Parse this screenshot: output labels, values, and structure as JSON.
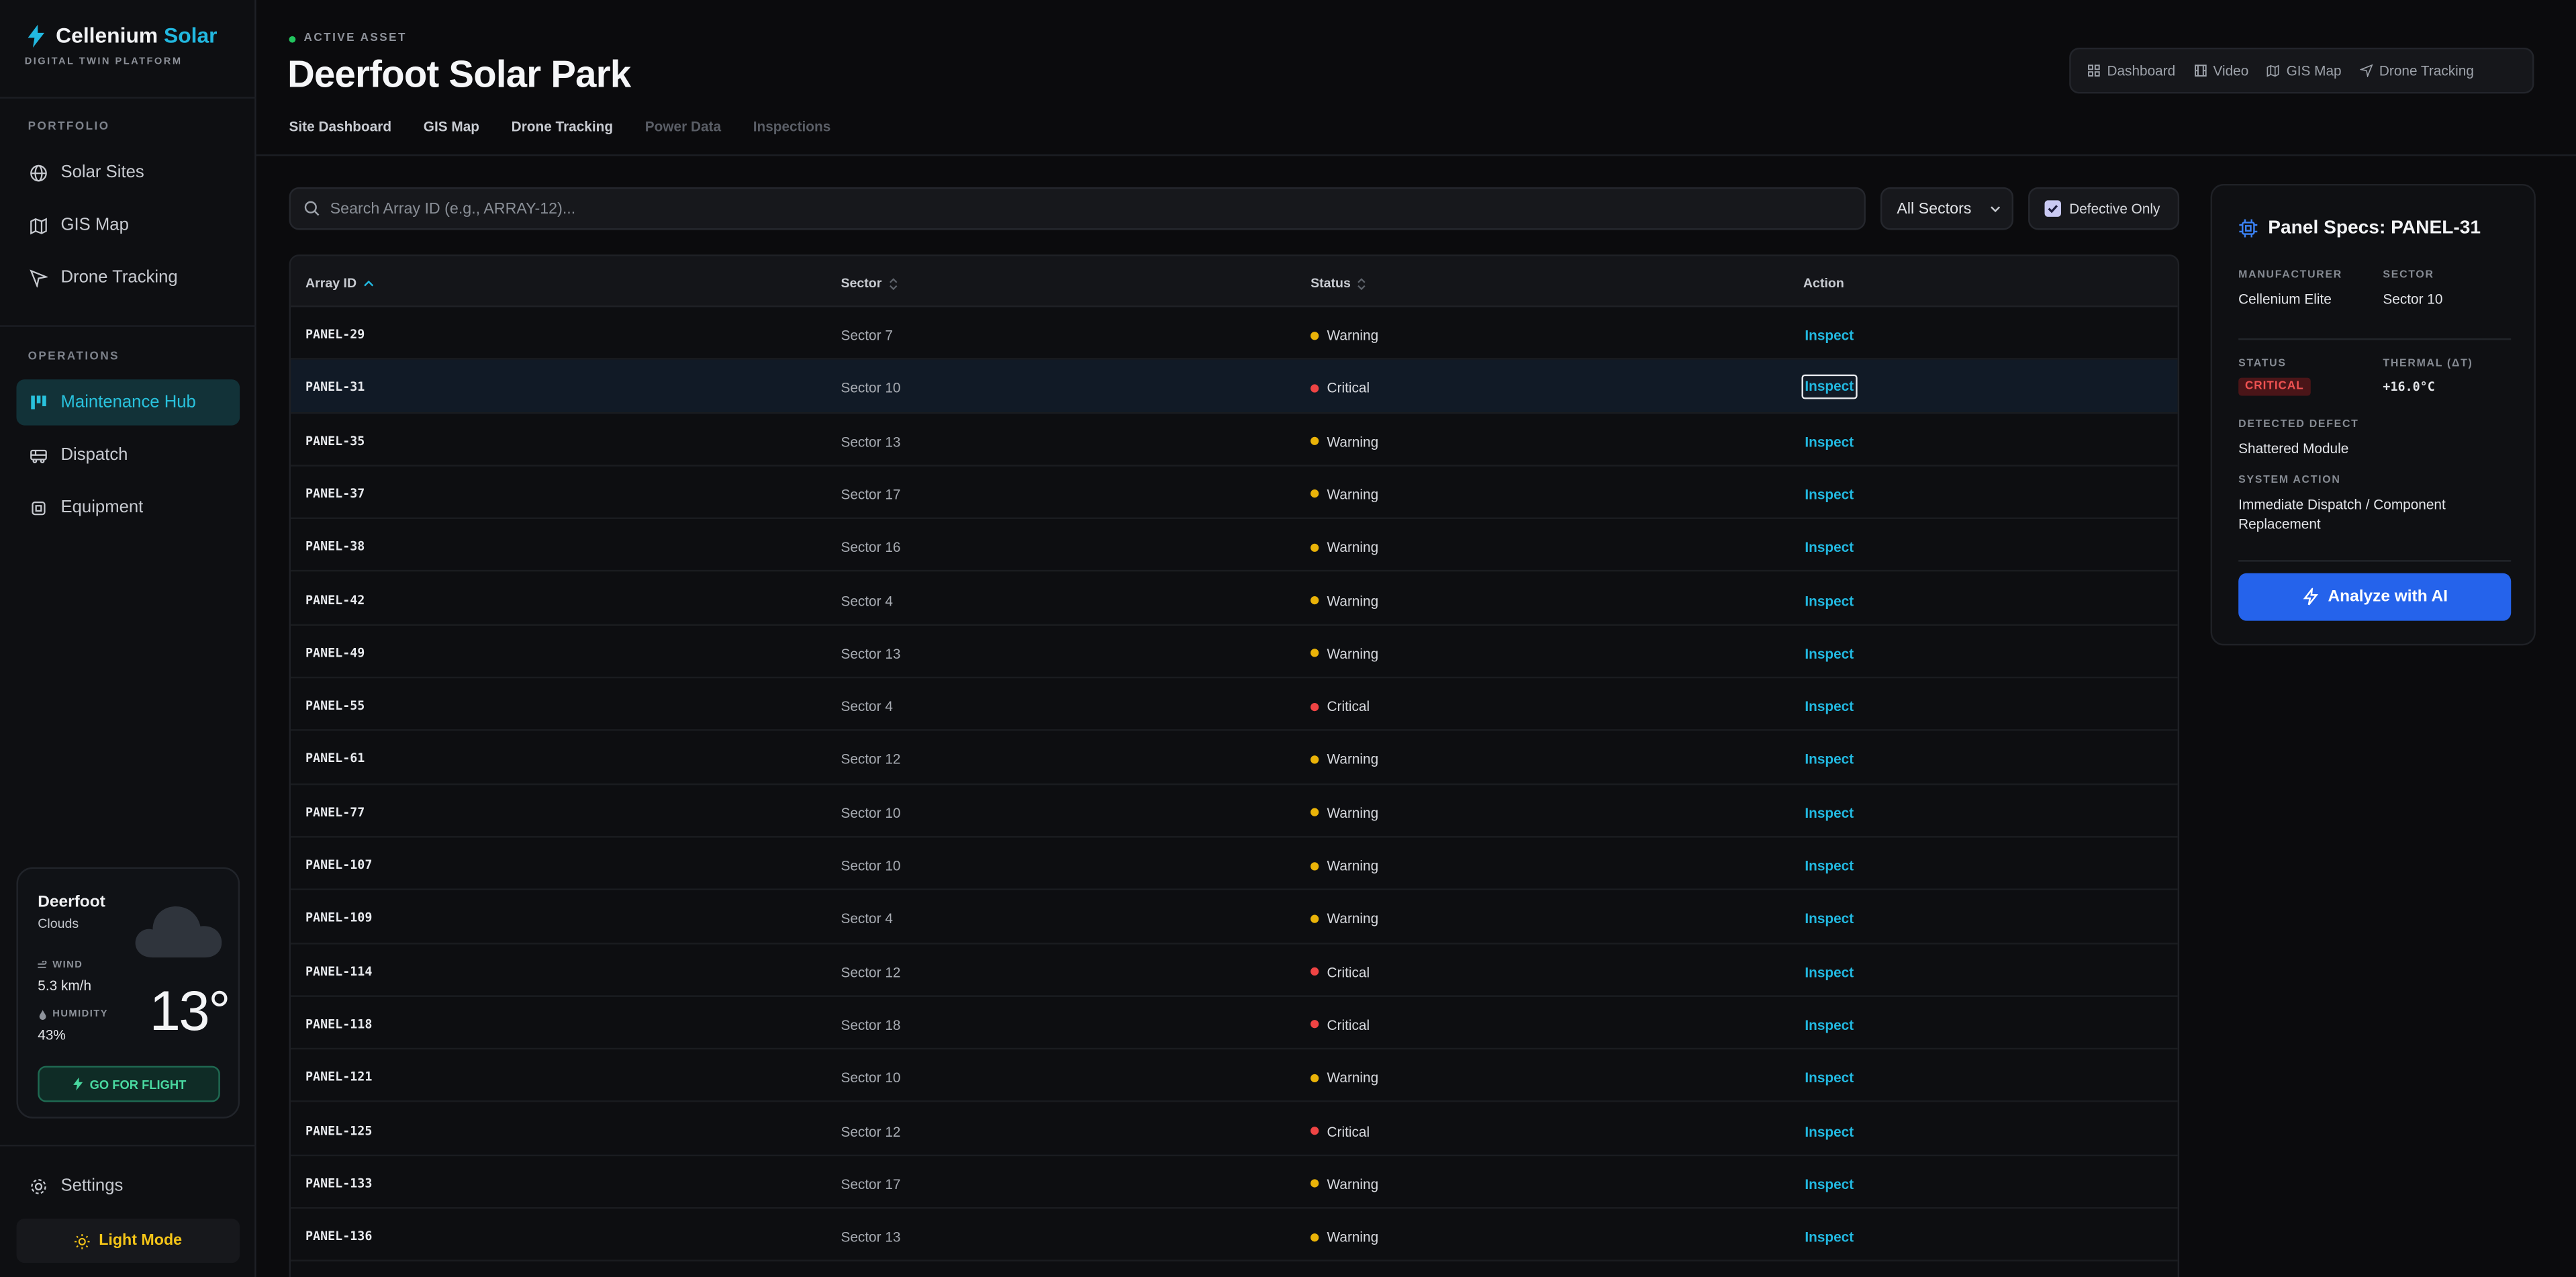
{
  "app": {
    "brand_primary": "Cellenium",
    "brand_accent": "Solar",
    "tagline": "DIGITAL TWIN PLATFORM"
  },
  "sidebar": {
    "portfolio_label": "PORTFOLIO",
    "operations_label": "OPERATIONS",
    "portfolio_items": [
      {
        "label": "Solar Sites",
        "icon": "globe-icon"
      },
      {
        "label": "GIS Map",
        "icon": "map-icon"
      },
      {
        "label": "Drone Tracking",
        "icon": "navigation-icon"
      }
    ],
    "operations_items": [
      {
        "label": "Maintenance Hub",
        "icon": "kanban-icon",
        "active": true
      },
      {
        "label": "Dispatch",
        "icon": "truck-icon"
      },
      {
        "label": "Equipment",
        "icon": "cpu-icon"
      }
    ],
    "settings_label": "Settings",
    "light_mode_label": "Light Mode"
  },
  "weather": {
    "city": "Deerfoot",
    "condition": "Clouds",
    "wind_label": "WIND",
    "wind_value": "5.3 km/h",
    "humidity_label": "HUMIDITY",
    "humidity_value": "43%",
    "temperature": "13°",
    "flight_button": "GO FOR FLIGHT"
  },
  "header": {
    "status_label": "ACTIVE ASSET",
    "title": "Deerfoot Solar Park",
    "tabs": [
      {
        "label": "Site Dashboard",
        "enabled": true
      },
      {
        "label": "GIS Map",
        "enabled": true
      },
      {
        "label": "Drone Tracking",
        "enabled": true
      },
      {
        "label": "Power Data",
        "enabled": false
      },
      {
        "label": "Inspections",
        "enabled": false
      }
    ],
    "quick_links": [
      {
        "label": "Dashboard",
        "icon": "grid-icon"
      },
      {
        "label": "Video",
        "icon": "film-icon"
      },
      {
        "label": "GIS Map",
        "icon": "map-icon"
      },
      {
        "label": "Drone Tracking",
        "icon": "navigation-icon"
      }
    ]
  },
  "filters": {
    "search_placeholder": "Search Array ID (e.g., ARRAY-12)...",
    "search_value": "",
    "sector_selected": "All Sectors",
    "defective_only_label": "Defective Only",
    "defective_only_checked": true
  },
  "table": {
    "columns": {
      "id": "Array ID",
      "sector": "Sector",
      "status": "Status",
      "action": "Action"
    },
    "sort_column": "Array ID",
    "sort_direction": "asc",
    "rows": [
      {
        "id": "PANEL-29",
        "sector": "Sector 7",
        "status": "Warning",
        "action": "Inspect"
      },
      {
        "id": "PANEL-31",
        "sector": "Sector 10",
        "status": "Critical",
        "action": "Inspect",
        "selected": true
      },
      {
        "id": "PANEL-35",
        "sector": "Sector 13",
        "status": "Warning",
        "action": "Inspect"
      },
      {
        "id": "PANEL-37",
        "sector": "Sector 17",
        "status": "Warning",
        "action": "Inspect"
      },
      {
        "id": "PANEL-38",
        "sector": "Sector 16",
        "status": "Warning",
        "action": "Inspect"
      },
      {
        "id": "PANEL-42",
        "sector": "Sector 4",
        "status": "Warning",
        "action": "Inspect"
      },
      {
        "id": "PANEL-49",
        "sector": "Sector 13",
        "status": "Warning",
        "action": "Inspect"
      },
      {
        "id": "PANEL-55",
        "sector": "Sector 4",
        "status": "Critical",
        "action": "Inspect"
      },
      {
        "id": "PANEL-61",
        "sector": "Sector 12",
        "status": "Warning",
        "action": "Inspect"
      },
      {
        "id": "PANEL-77",
        "sector": "Sector 10",
        "status": "Warning",
        "action": "Inspect"
      },
      {
        "id": "PANEL-107",
        "sector": "Sector 10",
        "status": "Warning",
        "action": "Inspect"
      },
      {
        "id": "PANEL-109",
        "sector": "Sector 4",
        "status": "Warning",
        "action": "Inspect"
      },
      {
        "id": "PANEL-114",
        "sector": "Sector 12",
        "status": "Critical",
        "action": "Inspect"
      },
      {
        "id": "PANEL-118",
        "sector": "Sector 18",
        "status": "Critical",
        "action": "Inspect"
      },
      {
        "id": "PANEL-121",
        "sector": "Sector 10",
        "status": "Warning",
        "action": "Inspect"
      },
      {
        "id": "PANEL-125",
        "sector": "Sector 12",
        "status": "Critical",
        "action": "Inspect"
      },
      {
        "id": "PANEL-133",
        "sector": "Sector 17",
        "status": "Warning",
        "action": "Inspect"
      },
      {
        "id": "PANEL-136",
        "sector": "Sector 13",
        "status": "Warning",
        "action": "Inspect"
      }
    ]
  },
  "status_colors": {
    "Warning": "#eab308",
    "Critical": "#ef4444"
  },
  "detail_panel": {
    "title": "Panel Specs: PANEL-31",
    "manufacturer_label": "MANUFACTURER",
    "manufacturer_value": "Cellenium Elite",
    "sector_label": "SECTOR",
    "sector_value": "Sector 10",
    "status_label": "STATUS",
    "status_badge": "CRITICAL",
    "thermal_label": "THERMAL (ΔT)",
    "thermal_value": "+16.0°C",
    "defect_label": "DETECTED DEFECT",
    "defect_value": "Shattered Module",
    "action_label": "SYSTEM ACTION",
    "action_value": "Immediate Dispatch / Component Replacement",
    "analyze_button": "Analyze with AI"
  }
}
